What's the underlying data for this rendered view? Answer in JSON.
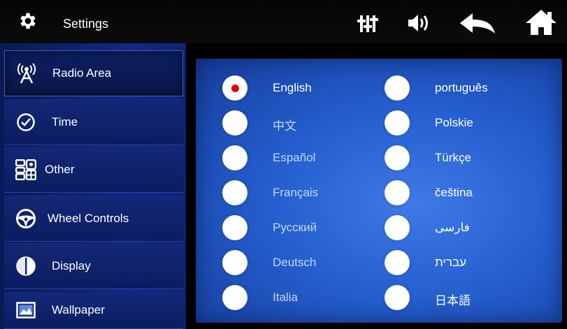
{
  "header": {
    "title": "Settings",
    "icons": [
      "gear-icon",
      "equalizer-icon",
      "volume-icon",
      "back-icon",
      "home-icon"
    ]
  },
  "sidebar": {
    "items": [
      {
        "label": "Radio Area",
        "icon": "radio-tower-icon",
        "active": true
      },
      {
        "label": "Time",
        "icon": "clock-icon",
        "active": false
      },
      {
        "label": "Other",
        "icon": "apps-grid-icon",
        "active": false
      },
      {
        "label": "Wheel Controls",
        "icon": "steering-wheel-icon",
        "active": false
      },
      {
        "label": "Display",
        "icon": "contrast-icon",
        "active": false
      },
      {
        "label": "Wallpaper",
        "icon": "image-icon",
        "active": false
      }
    ]
  },
  "languages": {
    "selected": "English",
    "left": [
      "English",
      "中文",
      "Español",
      "Français",
      "Русский",
      "Deutsch",
      "Italia"
    ],
    "right": [
      "português",
      "Polskie",
      "Türkçe",
      "čeština",
      "فارسی",
      "עברית",
      "日本語"
    ]
  },
  "colors": {
    "panel": "#2a63d4",
    "sidebar": "#0e2a86",
    "header": "#000000",
    "selected_dot": "#e00000"
  }
}
